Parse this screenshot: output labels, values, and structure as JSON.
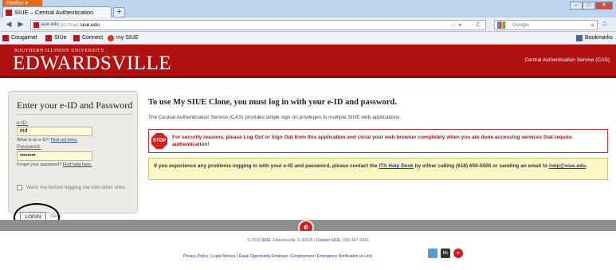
{
  "browser": {
    "menu_label": "Firefox ▾",
    "tab_title": "SIUE – Central Authentication Service",
    "new_tab": "+",
    "url_site": "siue.edu",
    "url_prefix": "https://cas.",
    "url_host": "siue.edu",
    "search_placeholder": "Google",
    "bookmarks": [
      "Cougarnet",
      "SIUe",
      "Connect",
      "my SIUE"
    ],
    "bookmarks_menu": "Bookmarks"
  },
  "header": {
    "logo_small": "SOUTHERN ILLINOIS UNIVERSITY",
    "logo_main": "EDWARDSVILLE",
    "service_name": "Central Authentication Service (CAS)"
  },
  "login": {
    "title": "Enter your e-ID and Password",
    "eid_label": "e-ID:",
    "eid_value": "eid",
    "eid_help": "What is an e-ID?",
    "eid_help_link": "Find out here.",
    "password_label": "Password:",
    "password_value": "••••••••",
    "password_help": "Forget your password?",
    "password_help_link": "Find help here.",
    "warn_label": "Warn me before logging me into other sites.",
    "login_button": "LOGIN",
    "clear_link": "clear"
  },
  "main": {
    "title": "To use My SIUE Clone, you must log in with your e-ID and password.",
    "description": "The Central Authentication Service (CAS) provides single sign-on privileges to multiple SIUE web applications.",
    "stop_icon_text": "STOP",
    "stop_message": "For security reasons, please Log Out or Sign Out from this application and close your web browser completely when you are done accessing services that require authentication!",
    "info_message_pre": "If you experience any problems logging in with your e-ID and password, please contact the",
    "info_link_1": "ITS Help Desk",
    "info_message_mid": "by either calling (618) 650-5500 or sending an email to",
    "info_link_2": "help@siue.edu",
    "info_message_end": "."
  },
  "footer": {
    "logo_letter": "e",
    "copyright_pre": "© 2010",
    "copyright_link": "SIUE",
    "copyright_post": ". Edwardsville, IL 62026 |",
    "contact_link": "Contact SIUE",
    "phone": "| 800-447-SIUE",
    "links": "Privacy Policy | Legal Notices | Equal Opportunity Employer | Employment | Emergency Notification (e-Lert)",
    "icon_labels": [
      "",
      "Bb",
      "e"
    ]
  },
  "colors": {
    "siue_red": "#b01212",
    "stop_red": "#d32020",
    "info_yellow": "#fbf7c4",
    "field_yellow": "#fffbd6"
  }
}
